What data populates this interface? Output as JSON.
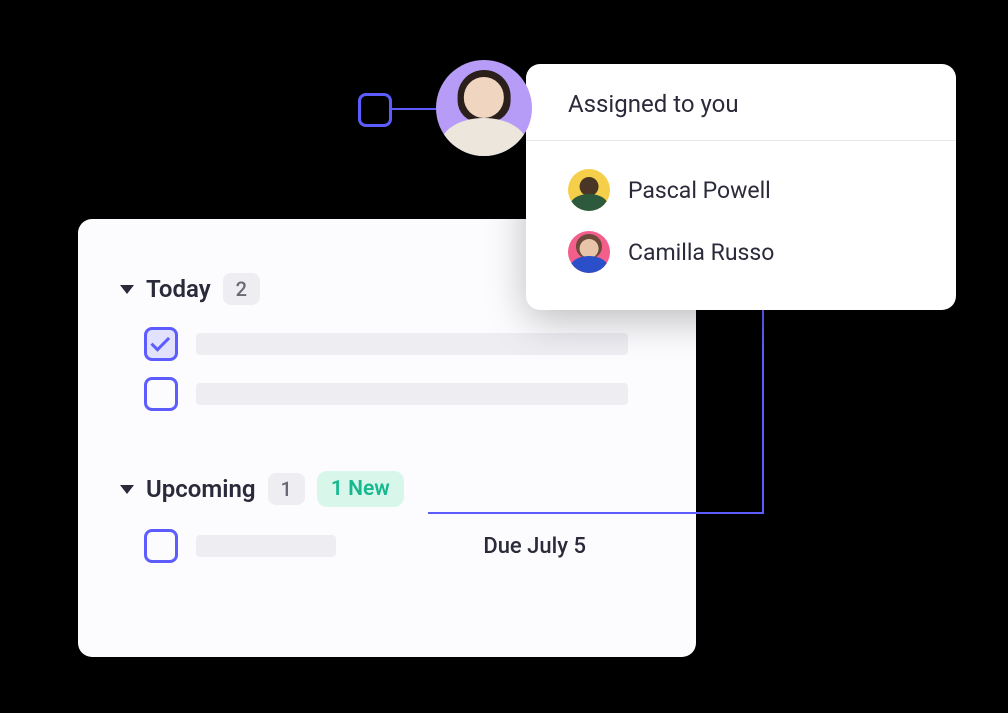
{
  "assignee_panel": {
    "title": "Assigned to you",
    "people": [
      {
        "name": "Pascal Powell"
      },
      {
        "name": "Camilla Russo"
      }
    ]
  },
  "sections": {
    "today": {
      "title": "Today",
      "count": "2"
    },
    "upcoming": {
      "title": "Upcoming",
      "count": "1",
      "new_badge": "1 New",
      "due": "Due July 5"
    }
  }
}
